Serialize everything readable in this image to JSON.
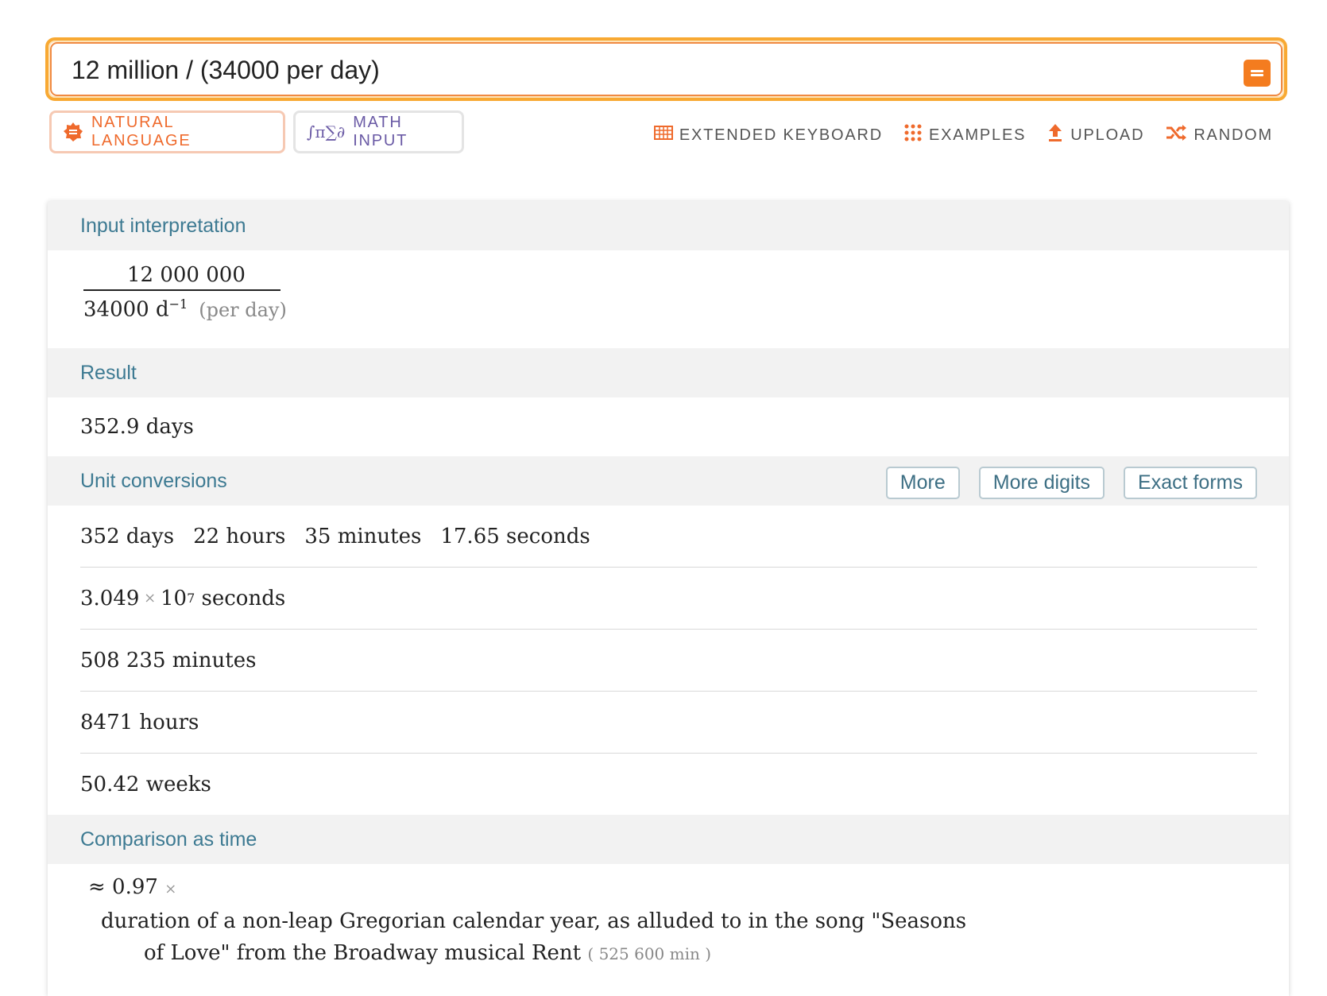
{
  "search": {
    "value": "12 million / (34000 per day)"
  },
  "modes": {
    "natural_language": "NATURAL LANGUAGE",
    "math_input": "MATH INPUT"
  },
  "toolbar": {
    "keyboard": "EXTENDED KEYBOARD",
    "examples": "EXAMPLES",
    "upload": "UPLOAD",
    "random": "RANDOM"
  },
  "pods": {
    "input": {
      "title": "Input interpretation",
      "numerator": "12 000 000",
      "denominator": "34000 d",
      "exponent": "−1",
      "unit_note": "(per day)"
    },
    "result": {
      "title": "Result",
      "value": "352.9 days"
    },
    "conversions": {
      "title": "Unit conversions",
      "buttons": {
        "more": "More",
        "more_digits": "More digits",
        "exact_forms": "Exact forms"
      },
      "mixed": [
        "352 days",
        "22 hours",
        "35 minutes",
        "17.65 seconds"
      ],
      "sci_mantissa": "3.049",
      "sci_base": "10",
      "sci_exp": "7",
      "sci_unit": "seconds",
      "minutes": "508 235 minutes",
      "hours": "8471 hours",
      "weeks": "50.42 weeks"
    },
    "comparison": {
      "title": "Comparison as time",
      "approx": "≈ 0.97",
      "times": "×",
      "desc_1": "duration of a non-leap Gregorian calendar year, as alluded to in the song \"Seasons",
      "desc_2": "of Love\" from the Broadway musical Rent",
      "note": "( 525 600 min )"
    }
  },
  "colors": {
    "accent": "#f47c1f",
    "pod_title": "#3d7a92",
    "math": "#6a5aa5"
  }
}
